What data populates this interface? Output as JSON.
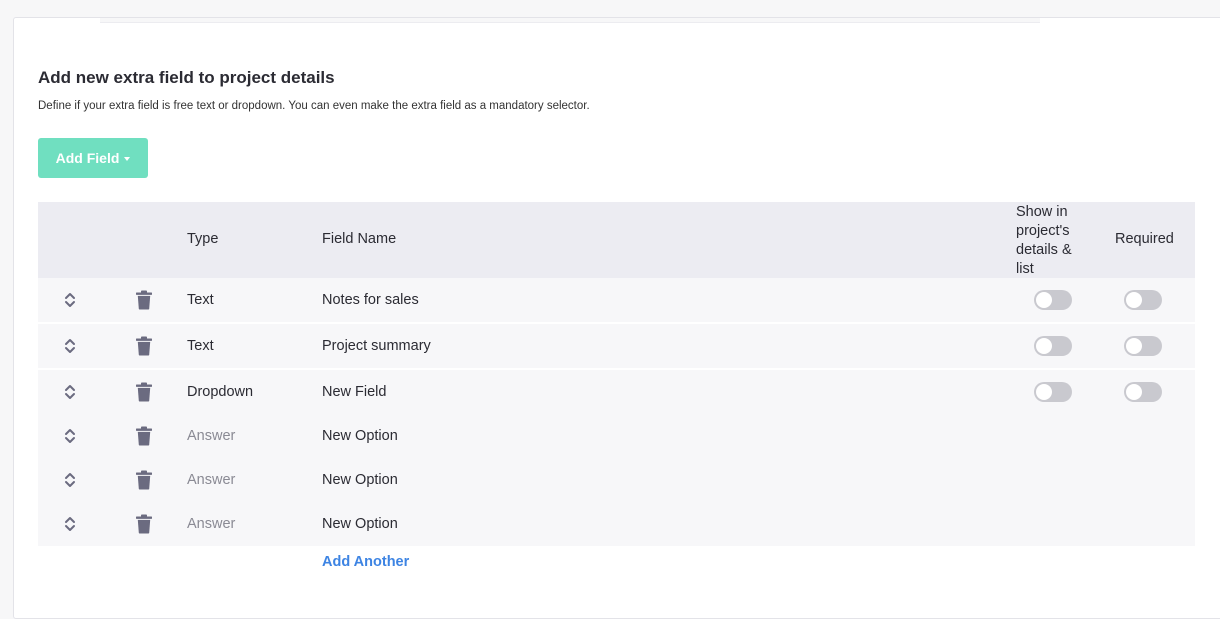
{
  "section": {
    "title": "Add new extra field to project details",
    "description": "Define if your extra field is free text or dropdown. You can even make the extra field as a mandatory selector."
  },
  "add_field_button": {
    "label": "Add Field"
  },
  "table": {
    "headers": {
      "type": "Type",
      "field_name": "Field Name",
      "show": "Show in project's details & list",
      "required": "Required"
    },
    "rows": [
      {
        "type": "Text",
        "field_name": "Notes for sales",
        "show": false,
        "required": false
      },
      {
        "type": "Text",
        "field_name": "Project summary",
        "show": false,
        "required": false
      },
      {
        "type": "Dropdown",
        "field_name": "New Field",
        "show": false,
        "required": false
      },
      {
        "type": "Answer",
        "field_name": "New Option"
      },
      {
        "type": "Answer",
        "field_name": "New Option"
      },
      {
        "type": "Answer",
        "field_name": "New Option"
      }
    ]
  },
  "add_another": {
    "label": "Add Another"
  },
  "colors": {
    "accent": "#70dfc0",
    "link": "#3d84e3",
    "icon": "#6b6b80"
  }
}
